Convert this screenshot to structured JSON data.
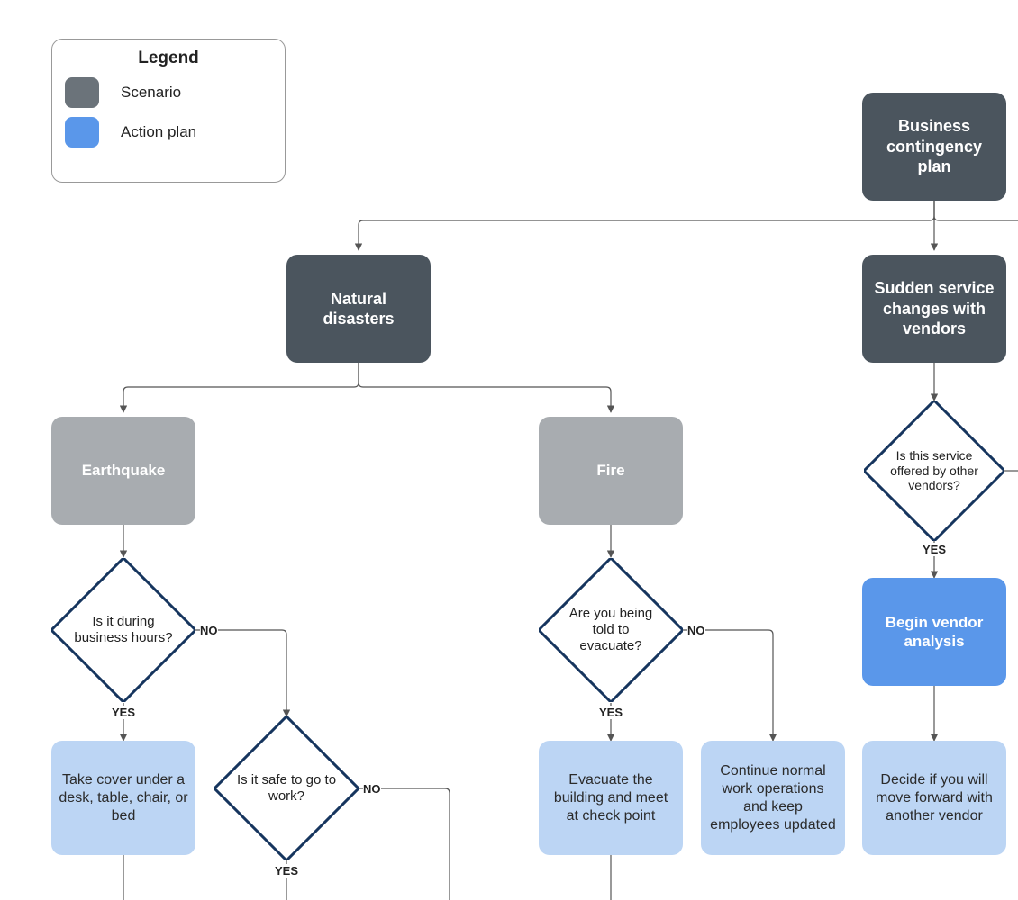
{
  "legend": {
    "title": "Legend",
    "items": [
      {
        "label": "Scenario",
        "color": "#6b737a"
      },
      {
        "label": "Action plan",
        "color": "#5a97ea"
      }
    ]
  },
  "root": {
    "label": "Business contingency plan"
  },
  "branches": {
    "natural": {
      "label": "Natural disasters"
    },
    "vendors": {
      "label": "Sudden service changes with vendors"
    }
  },
  "scenarios": {
    "earthquake": {
      "label": "Earthquake"
    },
    "fire": {
      "label": "Fire"
    }
  },
  "decisions": {
    "business_hours": {
      "label": "Is it during business hours?"
    },
    "safe_work": {
      "label": "Is it safe to go to work?"
    },
    "evacuate": {
      "label": "Are you being told to evacuate?"
    },
    "other_vendors": {
      "label": "Is this service offered by other vendors?"
    }
  },
  "actions": {
    "take_cover": {
      "label": "Take cover under a desk, table, chair, or bed"
    },
    "evac_meet": {
      "label": "Evacuate the building and meet at check point"
    },
    "normal_ops": {
      "label": "Continue normal work operations and keep employees updated"
    },
    "vendor_analysis": {
      "label": "Begin vendor analysis"
    },
    "decide_vendor": {
      "label": "Decide if you will move forward with another vendor"
    }
  },
  "labels": {
    "yes": "YES",
    "no": "NO"
  },
  "colors": {
    "scenario_dark": "#4b555e",
    "scenario_grey": "#a8acb0",
    "action": "#bcd5f4",
    "action_strong": "#5a97ea",
    "decision_border": "#16355e",
    "connector": "#555"
  }
}
